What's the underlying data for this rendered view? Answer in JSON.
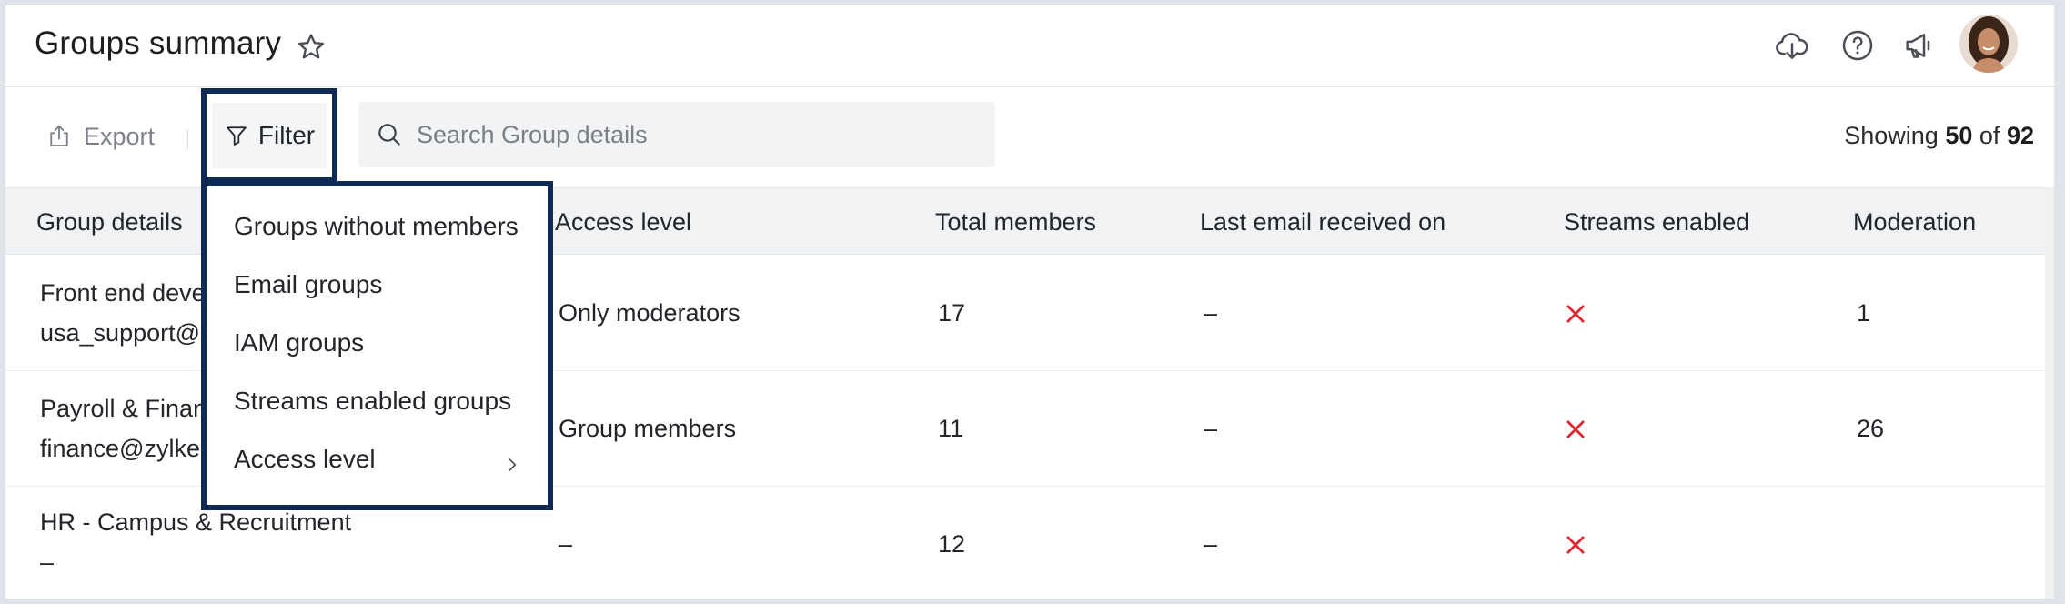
{
  "header": {
    "title": "Groups summary",
    "icons": [
      "star-icon",
      "cloud-download-icon",
      "help-icon",
      "announcement-icon",
      "avatar"
    ]
  },
  "toolbar": {
    "export_label": "Export",
    "filter_label": "Filter",
    "search_placeholder": "Search Group details",
    "showing_prefix": "Showing",
    "showing_count": "50",
    "showing_of": "of",
    "showing_total": "92"
  },
  "filter_menu": {
    "items": [
      {
        "label": "Groups without members"
      },
      {
        "label": "Email groups"
      },
      {
        "label": "IAM groups"
      },
      {
        "label": "Streams enabled groups"
      },
      {
        "label": "Access level",
        "has_submenu": true
      }
    ]
  },
  "table": {
    "columns": [
      "Group details",
      "Access level",
      "Total members",
      "Last email received on",
      "Streams enabled",
      "Moderation"
    ],
    "rows": [
      {
        "name": "Front end deve",
        "email": "usa_support@",
        "access": "Only moderators",
        "members": "17",
        "last_email": "–",
        "streams": "x",
        "moderation": "1"
      },
      {
        "name": "Payroll & Finan",
        "email": "finance@zylke",
        "access": "Group members",
        "members": "11",
        "last_email": "–",
        "streams": "x",
        "moderation": "26"
      },
      {
        "name": "HR - Campus & Recruitment",
        "email": "–",
        "access": "–",
        "members": "12",
        "last_email": "–",
        "streams": "x",
        "moderation": ""
      }
    ]
  },
  "colors": {
    "highlight_border": "#0f2b55",
    "cross_red": "#e0282e",
    "header_bg": "#f0f2f4"
  }
}
